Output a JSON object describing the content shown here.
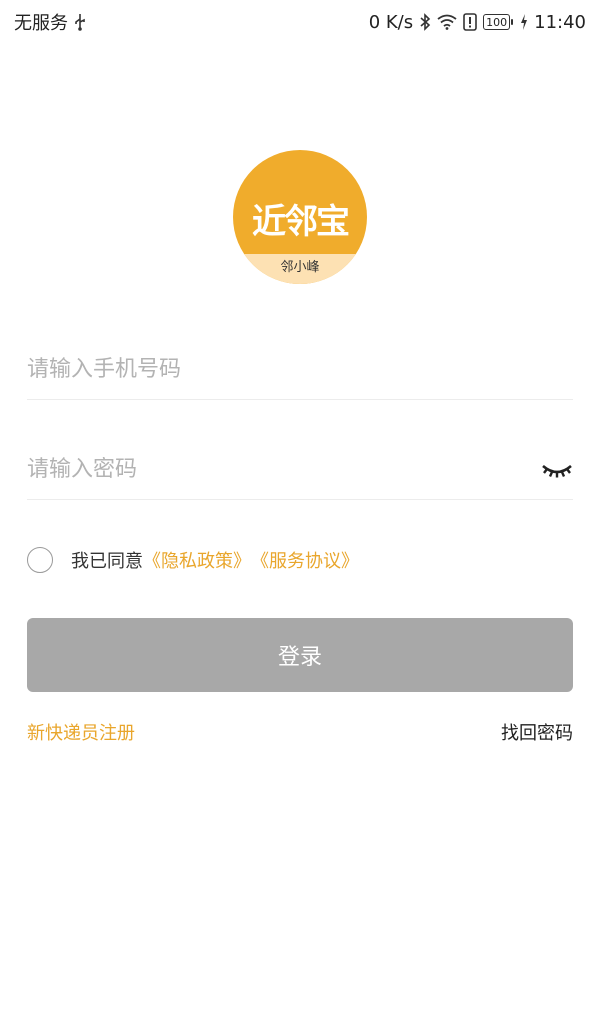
{
  "status_bar": {
    "carrier": "无服务",
    "net_speed": "0 K/s",
    "battery": "100",
    "time": "11:40",
    "icons": [
      "usb-icon",
      "bluetooth-icon",
      "wifi-icon",
      "alert-icon",
      "battery-icon",
      "charging-icon"
    ]
  },
  "logo": {
    "title": "近邻宝",
    "subtitle": "邻小峰",
    "color": "#f0ac2c",
    "band_color": "#fde1b3"
  },
  "form": {
    "phone_placeholder": "请输入手机号码",
    "phone_value": "",
    "password_placeholder": "请输入密码",
    "password_value": ""
  },
  "agreement": {
    "prefix": "我已同意",
    "privacy": "《隐私政策》",
    "service": "《服务协议》",
    "checked": false
  },
  "login_button": "登录",
  "links": {
    "register": "新快递员注册",
    "forgot": "找回密码"
  },
  "colors": {
    "accent": "#e9a62c",
    "button_disabled": "#a8a8a8"
  }
}
